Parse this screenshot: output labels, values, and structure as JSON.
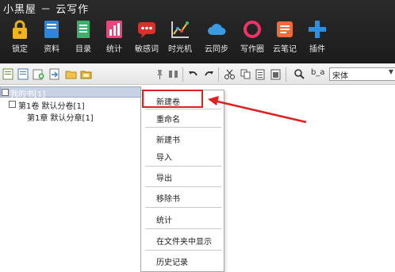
{
  "app": {
    "title": "小黑屋 － 云写作"
  },
  "main_toolbar": {
    "items": [
      {
        "label": "锁定",
        "icon": "lock-icon"
      },
      {
        "label": "资料",
        "icon": "book-icon"
      },
      {
        "label": "目录",
        "icon": "document-list-icon"
      },
      {
        "label": "统计",
        "icon": "bar-chart-icon"
      },
      {
        "label": "敏感词",
        "icon": "chat-bubble-icon"
      },
      {
        "label": "时光机",
        "icon": "timeline-chart-icon"
      },
      {
        "label": "云同步",
        "icon": "cloud-icon"
      },
      {
        "label": "写作圈",
        "icon": "ring-icon"
      },
      {
        "label": "云笔记",
        "icon": "note-icon"
      },
      {
        "label": "插件",
        "icon": "plus-icon"
      }
    ]
  },
  "format_toolbar": {
    "font": "宋体",
    "text_size_icon_label": "b_a"
  },
  "tree": {
    "root": "我的书[1]",
    "volume": "第1卷 默认分卷[1]",
    "chapter": "第1章 默认分章[1]"
  },
  "context_menu": {
    "items": [
      "新建卷",
      "重命名",
      "新建书",
      "导入",
      "导出",
      "移除书",
      "统计",
      "在文件夹中显示",
      "历史记录"
    ]
  },
  "colors": {
    "highlight": "#e02020",
    "topbar": "#1f1f1f"
  }
}
